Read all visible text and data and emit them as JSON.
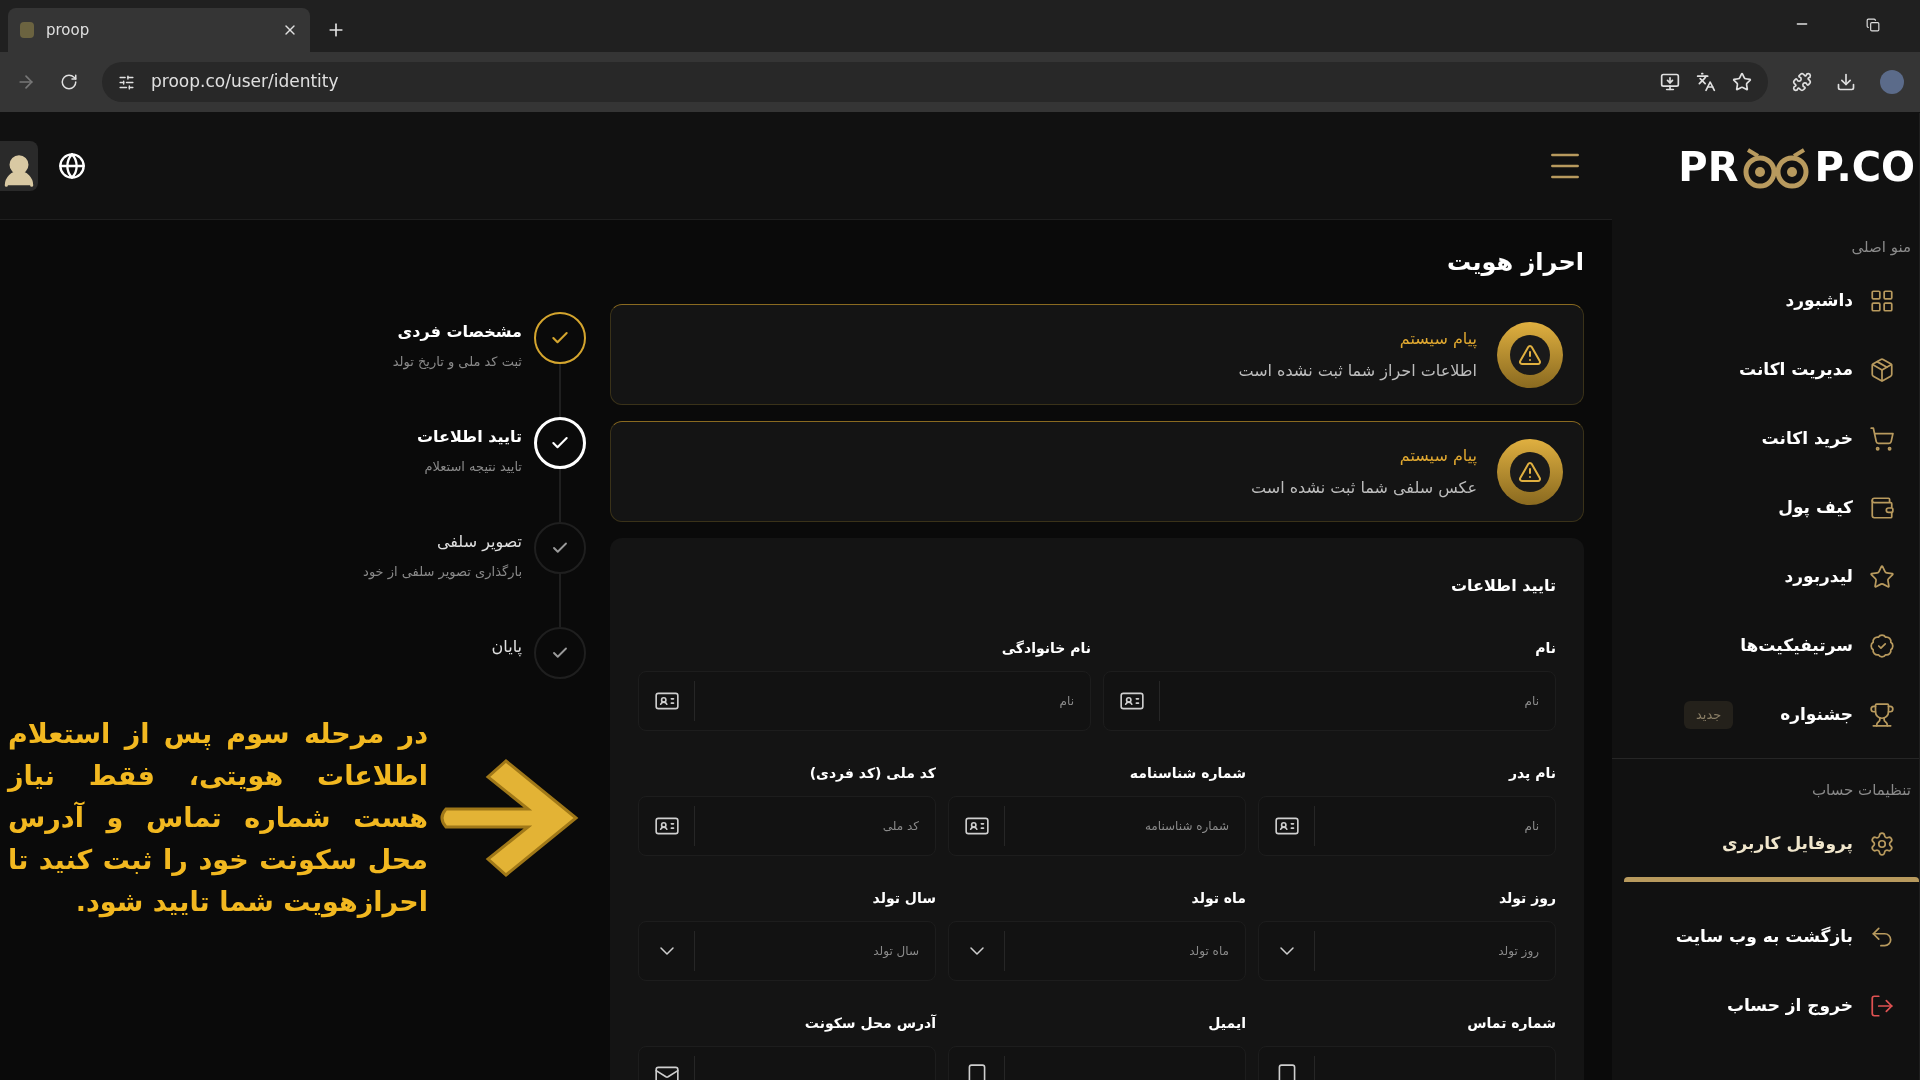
{
  "browser": {
    "tab_title": "proop",
    "url": "proop.co/user/identity"
  },
  "logo": {
    "left": "PR",
    "right": "P.CO"
  },
  "sidebar": {
    "sections": [
      {
        "title": "منو اصلی",
        "items": [
          {
            "label": "داشبورد",
            "selected": false
          },
          {
            "label": "مدیریت اکانت",
            "selected": false
          },
          {
            "label": "خرید اکانت",
            "selected": false
          },
          {
            "label": "کیف پول",
            "selected": false
          },
          {
            "label": "لیدربورد",
            "selected": false
          },
          {
            "label": "سرتیفیکیت‌ها",
            "selected": false
          },
          {
            "label": "جشنواره",
            "selected": false,
            "badge": "جدید"
          }
        ]
      },
      {
        "title": "تنظیمات حساب",
        "items": [
          {
            "label": "پروفایل کاربری",
            "selected": true
          }
        ]
      }
    ],
    "footer": [
      {
        "label": "بازگشت به وب سایت",
        "danger": false
      },
      {
        "label": "خروج از حساب",
        "danger": true
      }
    ]
  },
  "page_title": "احراز هویت",
  "alerts": [
    {
      "title": "پیام سیستم",
      "message": "اطلاعات احراز شما ثبت نشده است"
    },
    {
      "title": "پیام سیستم",
      "message": "عکس سلفی شما ثبت نشده است"
    }
  ],
  "steps": [
    {
      "title": "مشخصات فردی",
      "subtitle": "ثبت کد ملی و تاریخ تولد",
      "done": true,
      "selected": false
    },
    {
      "title": "تایید اطلاعات",
      "subtitle": "تایید نتیجه استعلام",
      "done": false,
      "selected": true
    },
    {
      "title": "تصویر سلفی",
      "subtitle": "بارگذاری تصویر سلفی از خود",
      "done": false,
      "selected": false
    },
    {
      "title": "پایان",
      "done": false,
      "selected": false
    }
  ],
  "annotation": "در مرحله سوم پس از استعلام اطلاعات هویتی، فقط نیاز هست شماره تماس و آدرس محل سکونت خود را ثبت کنید تا احرازهویت شما تایید شود.",
  "form": {
    "title": "تایید اطلاعات",
    "rows": [
      [
        {
          "label": "نام",
          "placeholder": "نام",
          "kind": "id"
        },
        {
          "label": "نام خانوادگی",
          "placeholder": "نام",
          "kind": "id"
        }
      ],
      [
        {
          "label": "نام پدر",
          "placeholder": "نام",
          "kind": "id"
        },
        {
          "label": "شماره شناسنامه",
          "placeholder": "شماره شناسنامه",
          "kind": "id"
        },
        {
          "label": "کد ملی (کد فردی)",
          "placeholder": "کد ملی",
          "kind": "id"
        }
      ],
      [
        {
          "label": "روز تولد",
          "placeholder": "روز تولد",
          "kind": "select"
        },
        {
          "label": "ماه تولد",
          "placeholder": "ماه تولد",
          "kind": "select"
        },
        {
          "label": "سال تولد",
          "placeholder": "سال تولد",
          "kind": "select"
        }
      ],
      [
        {
          "label": "شماره تماس",
          "kind": "phone"
        },
        {
          "label": "ایمیل",
          "kind": "phone"
        },
        {
          "label": "آدرس محل سکونت",
          "kind": "mail"
        }
      ]
    ]
  }
}
